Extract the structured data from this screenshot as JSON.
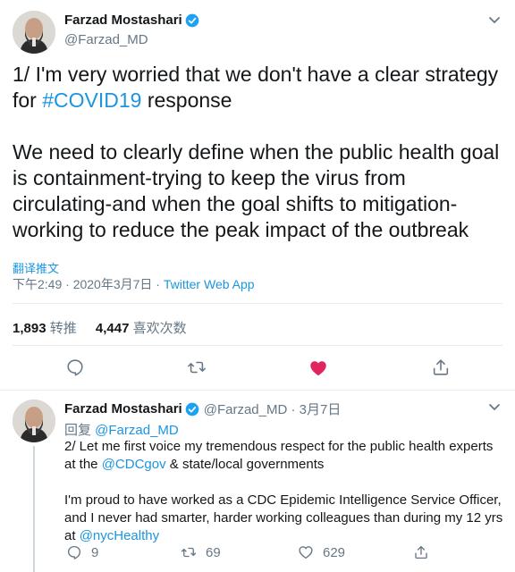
{
  "main_tweet": {
    "display_name": "Farzad Mostashari",
    "handle": "@Farzad_MD",
    "text_p1_a": "1/ I'm very worried that we don't have a clear strategy for ",
    "hashtag": "#COVID19",
    "text_p1_b": " response",
    "text_p2": "We need to clearly define when the public health goal is containment-trying to keep the virus from circulating-and when the goal shifts to mitigation-working to reduce the peak impact of the outbreak",
    "translate_label": "翻译推文",
    "timestamp": "下午2:49 · 2020年3月7日 · ",
    "source": "Twitter Web App",
    "retweets_count": "1,893",
    "retweets_label": "转推",
    "likes_count": "4,447",
    "likes_label": "喜欢次数",
    "liked": true,
    "like_color": "#e0245e"
  },
  "reply_tweet": {
    "display_name": "Farzad Mostashari",
    "handle_date": "@Farzad_MD · 3月7日",
    "replying_prefix": "回复 ",
    "replying_to": "@Farzad_MD",
    "line1_a": "2/ Let me first voice my tremendous respect for the public health experts at the ",
    "line1_mention": "@CDCgov",
    "line1_b": " & state/local governments",
    "line2_a": "I'm proud to have worked as a CDC Epidemic Intelligence Service Officer, and I never had smarter, harder working colleagues than during my 12 yrs at ",
    "line2_mention": "@nycHealthy",
    "reply_count": "9",
    "retweet_count": "69",
    "like_count": "629"
  },
  "icons": {
    "verified": "verified-badge-icon",
    "caret": "chevron-down-icon",
    "reply": "reply-icon",
    "retweet": "retweet-icon",
    "like": "heart-icon",
    "share": "share-icon"
  },
  "colors": {
    "accent": "#1b95e0",
    "secondary_text": "#657786",
    "verified": "#1da1f2"
  }
}
